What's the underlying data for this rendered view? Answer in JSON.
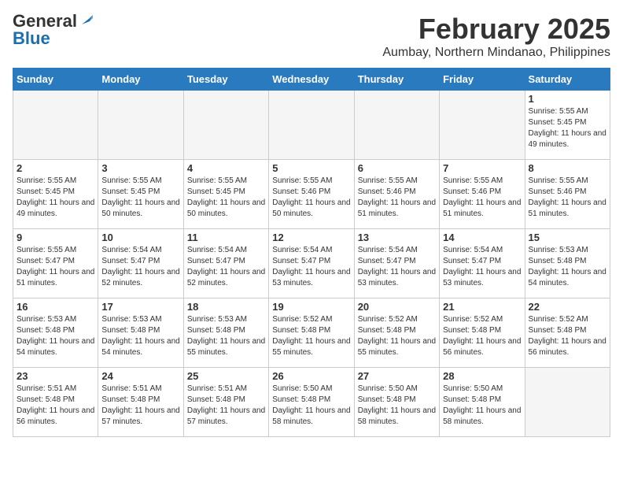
{
  "header": {
    "logo_general": "General",
    "logo_blue": "Blue",
    "month_title": "February 2025",
    "location": "Aumbay, Northern Mindanao, Philippines"
  },
  "days_of_week": [
    "Sunday",
    "Monday",
    "Tuesday",
    "Wednesday",
    "Thursday",
    "Friday",
    "Saturday"
  ],
  "weeks": [
    [
      {
        "day": "",
        "empty": true
      },
      {
        "day": "",
        "empty": true
      },
      {
        "day": "",
        "empty": true
      },
      {
        "day": "",
        "empty": true
      },
      {
        "day": "",
        "empty": true
      },
      {
        "day": "",
        "empty": true
      },
      {
        "day": "1",
        "sunrise": "5:55 AM",
        "sunset": "5:45 PM",
        "daylight": "11 hours and 49 minutes."
      }
    ],
    [
      {
        "day": "2",
        "sunrise": "5:55 AM",
        "sunset": "5:45 PM",
        "daylight": "11 hours and 49 minutes."
      },
      {
        "day": "3",
        "sunrise": "5:55 AM",
        "sunset": "5:45 PM",
        "daylight": "11 hours and 50 minutes."
      },
      {
        "day": "4",
        "sunrise": "5:55 AM",
        "sunset": "5:45 PM",
        "daylight": "11 hours and 50 minutes."
      },
      {
        "day": "5",
        "sunrise": "5:55 AM",
        "sunset": "5:46 PM",
        "daylight": "11 hours and 50 minutes."
      },
      {
        "day": "6",
        "sunrise": "5:55 AM",
        "sunset": "5:46 PM",
        "daylight": "11 hours and 51 minutes."
      },
      {
        "day": "7",
        "sunrise": "5:55 AM",
        "sunset": "5:46 PM",
        "daylight": "11 hours and 51 minutes."
      },
      {
        "day": "8",
        "sunrise": "5:55 AM",
        "sunset": "5:46 PM",
        "daylight": "11 hours and 51 minutes."
      }
    ],
    [
      {
        "day": "9",
        "sunrise": "5:55 AM",
        "sunset": "5:47 PM",
        "daylight": "11 hours and 51 minutes."
      },
      {
        "day": "10",
        "sunrise": "5:54 AM",
        "sunset": "5:47 PM",
        "daylight": "11 hours and 52 minutes."
      },
      {
        "day": "11",
        "sunrise": "5:54 AM",
        "sunset": "5:47 PM",
        "daylight": "11 hours and 52 minutes."
      },
      {
        "day": "12",
        "sunrise": "5:54 AM",
        "sunset": "5:47 PM",
        "daylight": "11 hours and 53 minutes."
      },
      {
        "day": "13",
        "sunrise": "5:54 AM",
        "sunset": "5:47 PM",
        "daylight": "11 hours and 53 minutes."
      },
      {
        "day": "14",
        "sunrise": "5:54 AM",
        "sunset": "5:47 PM",
        "daylight": "11 hours and 53 minutes."
      },
      {
        "day": "15",
        "sunrise": "5:53 AM",
        "sunset": "5:48 PM",
        "daylight": "11 hours and 54 minutes."
      }
    ],
    [
      {
        "day": "16",
        "sunrise": "5:53 AM",
        "sunset": "5:48 PM",
        "daylight": "11 hours and 54 minutes."
      },
      {
        "day": "17",
        "sunrise": "5:53 AM",
        "sunset": "5:48 PM",
        "daylight": "11 hours and 54 minutes."
      },
      {
        "day": "18",
        "sunrise": "5:53 AM",
        "sunset": "5:48 PM",
        "daylight": "11 hours and 55 minutes."
      },
      {
        "day": "19",
        "sunrise": "5:52 AM",
        "sunset": "5:48 PM",
        "daylight": "11 hours and 55 minutes."
      },
      {
        "day": "20",
        "sunrise": "5:52 AM",
        "sunset": "5:48 PM",
        "daylight": "11 hours and 55 minutes."
      },
      {
        "day": "21",
        "sunrise": "5:52 AM",
        "sunset": "5:48 PM",
        "daylight": "11 hours and 56 minutes."
      },
      {
        "day": "22",
        "sunrise": "5:52 AM",
        "sunset": "5:48 PM",
        "daylight": "11 hours and 56 minutes."
      }
    ],
    [
      {
        "day": "23",
        "sunrise": "5:51 AM",
        "sunset": "5:48 PM",
        "daylight": "11 hours and 56 minutes."
      },
      {
        "day": "24",
        "sunrise": "5:51 AM",
        "sunset": "5:48 PM",
        "daylight": "11 hours and 57 minutes."
      },
      {
        "day": "25",
        "sunrise": "5:51 AM",
        "sunset": "5:48 PM",
        "daylight": "11 hours and 57 minutes."
      },
      {
        "day": "26",
        "sunrise": "5:50 AM",
        "sunset": "5:48 PM",
        "daylight": "11 hours and 58 minutes."
      },
      {
        "day": "27",
        "sunrise": "5:50 AM",
        "sunset": "5:48 PM",
        "daylight": "11 hours and 58 minutes."
      },
      {
        "day": "28",
        "sunrise": "5:50 AM",
        "sunset": "5:48 PM",
        "daylight": "11 hours and 58 minutes."
      },
      {
        "day": "",
        "empty": true
      }
    ]
  ]
}
